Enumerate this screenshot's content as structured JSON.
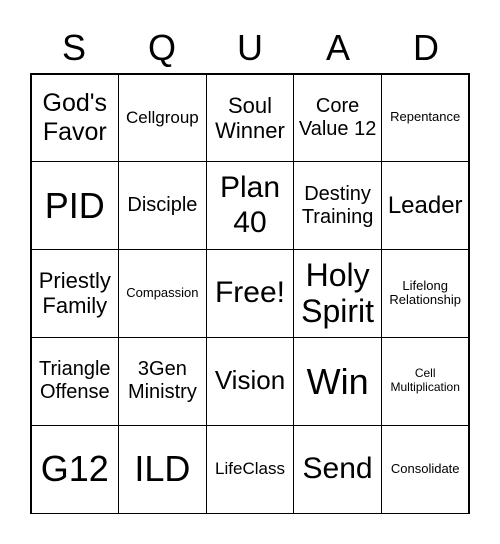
{
  "header": [
    "S",
    "Q",
    "U",
    "A",
    "D"
  ],
  "cells": [
    "God's Favor",
    "Cellgroup",
    "Soul Winner",
    "Core Value 12",
    "Repentance",
    "PID",
    "Disciple",
    "Plan 40",
    "Destiny Training",
    "Leader",
    "Priestly Family",
    "Compassion",
    "Free!",
    "Holy Spirit",
    "Lifelong Relationship",
    "Triangle Offense",
    "3Gen Ministry",
    "Vision",
    "Win",
    "Cell Multiplication",
    "G12",
    "ILD",
    "LifeClass",
    "Send",
    "Consolidate"
  ]
}
